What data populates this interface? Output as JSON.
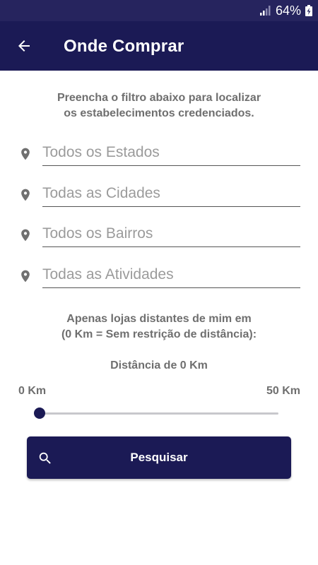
{
  "status_bar": {
    "battery_percent": "64%",
    "signal_icon": "signal-bars-icon",
    "battery_icon": "battery-charging-icon"
  },
  "app_bar": {
    "title": "Onde Comprar",
    "back_icon": "arrow-left-icon"
  },
  "filters": {
    "intro_line1": "Preencha o filtro abaixo para localizar",
    "intro_line2": "os estabelecimentos credenciados.",
    "fields": [
      {
        "placeholder": "Todos os Estados",
        "value": "",
        "icon": "location-pin-icon"
      },
      {
        "placeholder": "Todas as Cidades",
        "value": "",
        "icon": "location-pin-icon"
      },
      {
        "placeholder": "Todos os Bairros",
        "value": "",
        "icon": "location-pin-icon"
      },
      {
        "placeholder": "Todas as Atividades",
        "value": "",
        "icon": "location-pin-icon"
      }
    ]
  },
  "distance": {
    "info_line1": "Apenas lojas distantes de mim em",
    "info_line2": "(0 Km = Sem restrição de distância):",
    "current_label": "Distância de 0 Km",
    "min_label": "0 Km",
    "max_label": "50 Km",
    "value_km": 0,
    "max_km": 50
  },
  "search_button": {
    "label": "Pesquisar",
    "icon": "search-icon"
  },
  "colors": {
    "primary": "#1b1a55",
    "status_bar": "#26245e",
    "text_gray": "#6f6f6f",
    "placeholder_gray": "#9b9b9b"
  }
}
